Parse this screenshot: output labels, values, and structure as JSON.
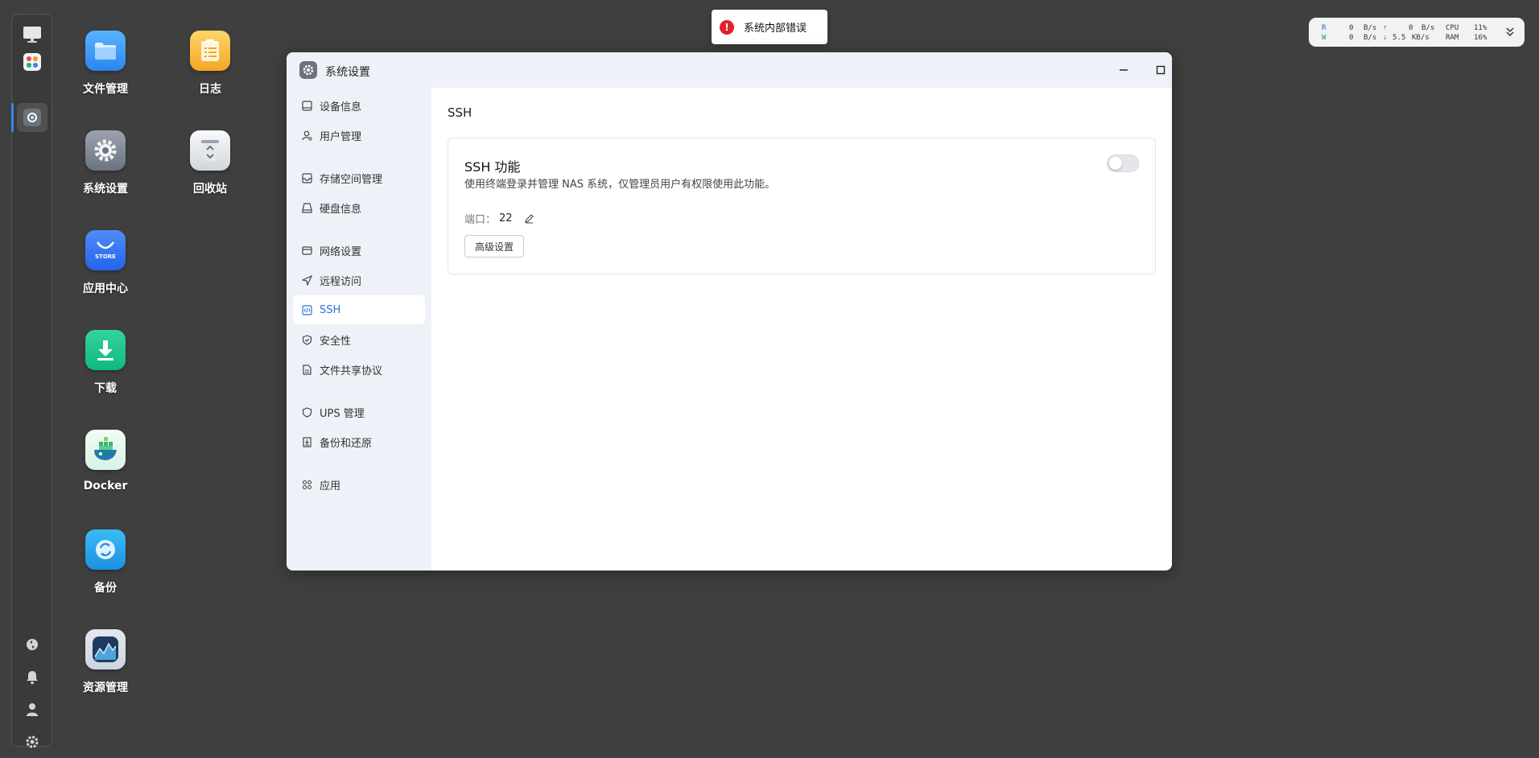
{
  "desktop": {
    "icons": [
      {
        "label": "文件管理"
      },
      {
        "label": "日志"
      },
      {
        "label": "系统设置"
      },
      {
        "label": "回收站"
      },
      {
        "label": "应用中心",
        "badge": "STORE"
      },
      {
        "label": "下载"
      },
      {
        "label": "Docker"
      },
      {
        "label": "备份"
      },
      {
        "label": "资源管理"
      }
    ]
  },
  "dock": {
    "items": [
      "monitor-icon",
      "app-grid-icon",
      "settings-icon"
    ],
    "bottom_items": [
      "network-icon",
      "bell-icon",
      "user-icon",
      "gear-icon"
    ]
  },
  "toast": {
    "message": "系统内部错误",
    "icon": "!",
    "color": "#e0202e"
  },
  "stats": {
    "r_label": "R",
    "w_label": "W",
    "r_value": "0",
    "r_unit": "B/s",
    "w_value": "0",
    "w_unit": "B/s",
    "up_value": "0",
    "up_unit": "B/s",
    "down_value": "5.5",
    "down_unit": "KB/s",
    "cpu_label": "CPU",
    "cpu_value": "11%",
    "ram_label": "RAM",
    "ram_value": "16%"
  },
  "window": {
    "title": "系统设置",
    "sidebar": [
      {
        "label": "设备信息",
        "icon": "device-icon"
      },
      {
        "label": "用户管理",
        "icon": "user-manage-icon"
      },
      {
        "label": "存储空间管理",
        "icon": "storage-icon"
      },
      {
        "label": "硬盘信息",
        "icon": "disk-icon"
      },
      {
        "label": "网络设置",
        "icon": "network-settings-icon"
      },
      {
        "label": "远程访问",
        "icon": "remote-icon"
      },
      {
        "label": "SSH",
        "icon": "ssh-icon",
        "active": true
      },
      {
        "label": "安全性",
        "icon": "shield-check-icon"
      },
      {
        "label": "文件共享协议",
        "icon": "file-share-icon"
      },
      {
        "label": "UPS 管理",
        "icon": "ups-icon"
      },
      {
        "label": "备份和还原",
        "icon": "backup-restore-icon"
      },
      {
        "label": "应用",
        "icon": "apps-icon"
      }
    ],
    "content": {
      "page_title": "SSH",
      "card": {
        "title": "SSH 功能",
        "description": "使用终端登录并管理 NAS 系统，仅管理员用户有权限使用此功能。",
        "port_label": "端口：",
        "port_value": "22",
        "advanced_button": "高级设置",
        "enabled": false
      }
    }
  },
  "colors": {
    "accent": "#2f6fd8",
    "error": "#e0202e"
  }
}
